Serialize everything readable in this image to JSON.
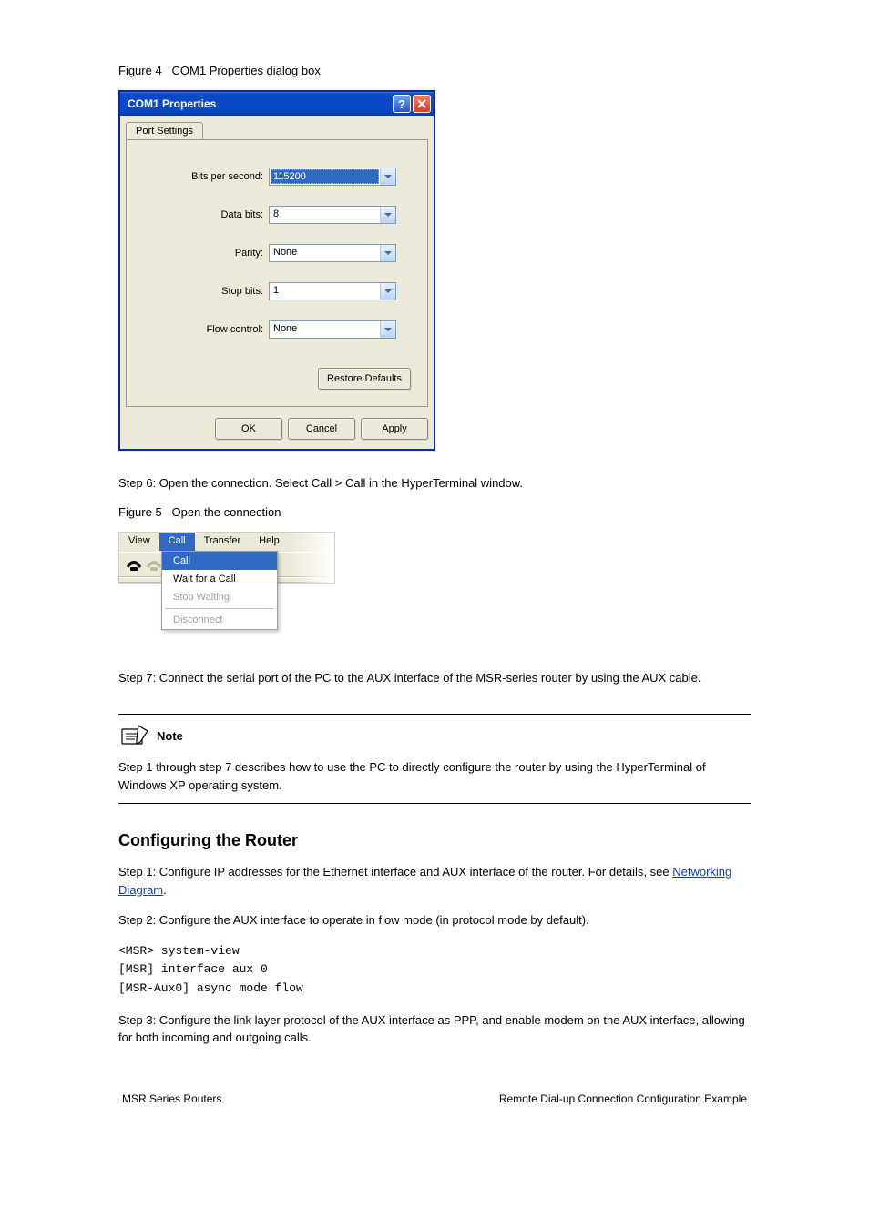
{
  "fig1": {
    "caption": "Figure 4   COM1 Properties dialog box",
    "title": "COM1 Properties",
    "tab": "Port Settings",
    "rows": {
      "bps": {
        "label": "Bits per second:",
        "value": "115200"
      },
      "databits": {
        "label": "Data bits:",
        "value": "8"
      },
      "parity": {
        "label": "Parity:",
        "value": "None"
      },
      "stopbits": {
        "label": "Stop bits:",
        "value": "1"
      },
      "flow": {
        "label": "Flow control:",
        "value": "None"
      }
    },
    "restore": "Restore Defaults",
    "ok": "OK",
    "cancel": "Cancel",
    "apply": "Apply"
  },
  "para_after_fig1": "Step 6: Open the connection. Select Call > Call in the HyperTerminal window.",
  "fig2": {
    "caption": "Figure 5   Open the connection",
    "menus": {
      "view": "View",
      "call": "Call",
      "transfer": "Transfer",
      "help": "Help"
    },
    "dropdown": {
      "call": "Call",
      "wait": "Wait for a Call",
      "stop": "Stop Waiting",
      "disc": "Disconnect"
    }
  },
  "para_after_fig2": "Step 7: Connect the serial port of the PC to the AUX interface of the MSR-series router by using the AUX cable.",
  "note": {
    "label": "Note",
    "body": "Step 1 through step 7 describes how to use the PC to directly configure the router by using the HyperTerminal of Windows XP operating system."
  },
  "section": {
    "title": "Configuring the Router",
    "p1_a": "Step 1: Configure IP addresses for the Ethernet interface and AUX interface of the router. For details, see ",
    "p1_link": "Networking Diagram",
    "p1_b": ".",
    "p2": "Step 2: Configure the AUX interface to operate in flow mode (in protocol mode by default).",
    "cmd1": "<MSR> system-view",
    "cmd2": "[MSR] interface aux 0",
    "cmd3": "[MSR-Aux0] async mode flow",
    "p3": "Step 3: Configure the link layer protocol of the AUX interface as PPP, and enable modem on the AUX interface, allowing for both incoming and outgoing calls."
  },
  "footer": {
    "left": "MSR Series Routers",
    "right": "Remote Dial-up Connection Configuration Example"
  }
}
